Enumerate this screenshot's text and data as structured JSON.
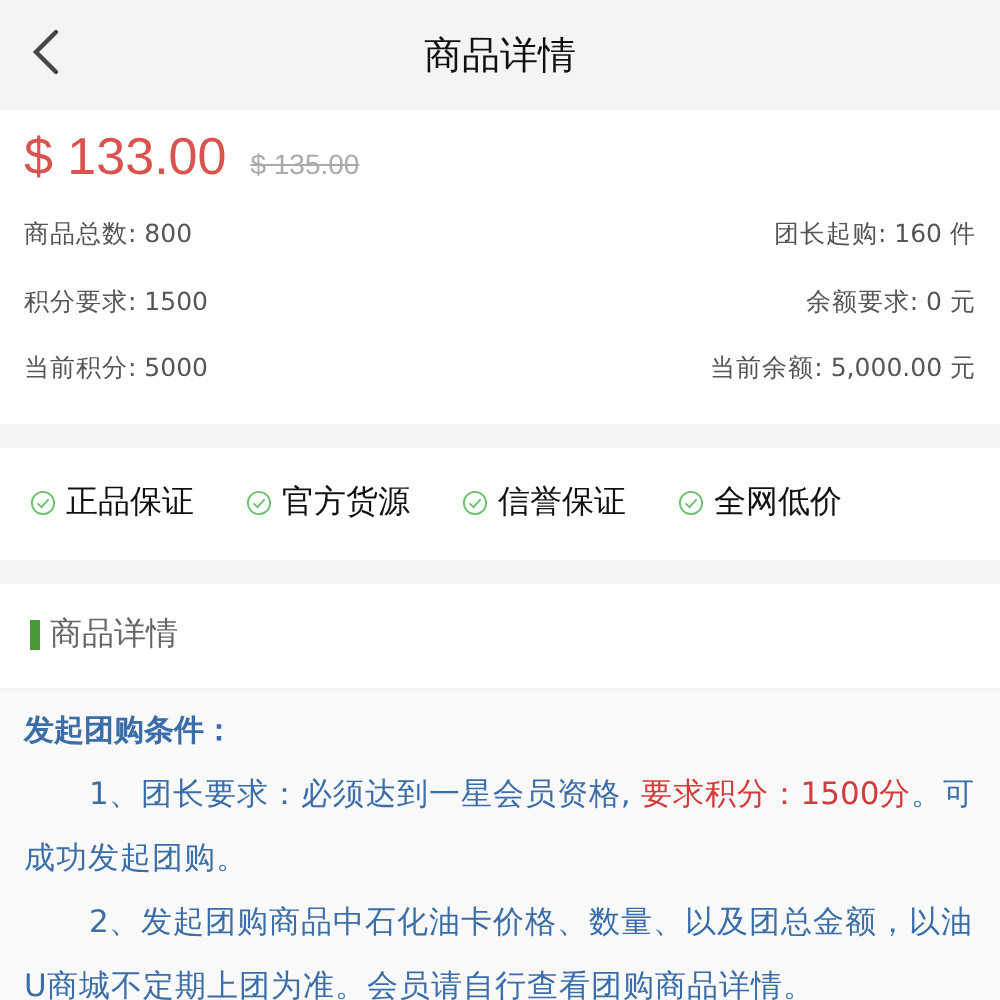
{
  "header": {
    "title": "商品详情"
  },
  "price": {
    "current": "$ 133.00",
    "original": "$ 135.00"
  },
  "info_rows": [
    {
      "left": "商品总数: 800",
      "right": "团长起购: 160 件"
    },
    {
      "left": "积分要求: 1500",
      "right": "余额要求: 0 元"
    },
    {
      "left": "当前积分: 5000",
      "right": "当前余额: 5,000.00 元"
    }
  ],
  "guarantees": [
    "正品保证",
    "官方货源",
    "信誉保证",
    "全网低价"
  ],
  "section": {
    "title": "商品详情"
  },
  "details": {
    "heading": "发起团购条件：",
    "paragraphs": [
      {
        "parts": [
          {
            "kind": "normal",
            "text": "1、团长要求：必须达到一星会员资格, "
          },
          {
            "kind": "highlight",
            "text": "要求积分：1500分"
          },
          {
            "kind": "normal",
            "text": "。可成功发起团购。"
          }
        ]
      },
      {
        "parts": [
          {
            "kind": "normal",
            "text": "2、发起团购商品中石化油卡价格、数量、以及团总金额，以油U商城不定期上团为准。会员请自行查看团购商品详情。"
          }
        ]
      }
    ]
  }
}
